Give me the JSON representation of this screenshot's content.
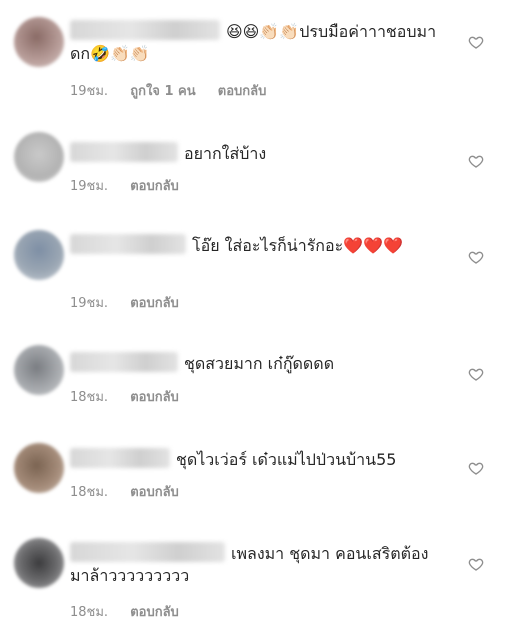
{
  "comments": [
    {
      "text": "😆😆👏🏻👏🏻ปรบมือค่าาาชอบมาดก🤣👏🏻👏🏻",
      "time": "19ชม.",
      "likes": "ถูกใจ 1 คน",
      "reply": "ตอบกลับ"
    },
    {
      "text": "อยากใส่บ้าง",
      "time": "19ชม.",
      "reply": "ตอบกลับ"
    },
    {
      "text": "โอ๊ย ใส่อะไรก็น่ารักอะ❤️❤️❤️",
      "time": "19ชม.",
      "reply": "ตอบกลับ"
    },
    {
      "text": "ชุดสวยมาก เก๋กู๊ดดดด",
      "time": "18ชม.",
      "reply": "ตอบกลับ"
    },
    {
      "text": "ชุดไวเว่อร์ เด๋วแม่ไปป่วนบ้าน55",
      "time": "18ชม.",
      "reply": "ตอบกลับ"
    },
    {
      "text": "เพลงมา ชุดมา คอนเสริตต้องมาล้าววววววววว",
      "time": "18ชม.",
      "reply": "ตอบกลับ"
    }
  ],
  "colors": {
    "text": "#262626",
    "meta": "#8e8e8e",
    "heart_outline": "#8e8e8e"
  },
  "icons": {
    "like": "heart-outline-icon"
  }
}
